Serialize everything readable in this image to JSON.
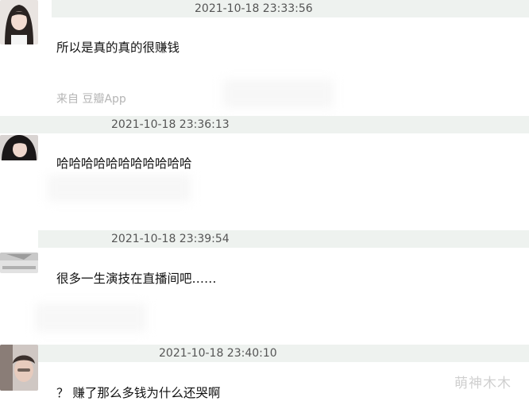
{
  "comments": [
    {
      "timestamp": "2021-10-18 23:33:56",
      "text": "所以是真的真的很赚钱",
      "source": "来自 豆瓣App"
    },
    {
      "timestamp": "2021-10-18 23:36:13",
      "text": "哈哈哈哈哈哈哈哈哈哈哈"
    },
    {
      "timestamp": "2021-10-18 23:39:54",
      "text": "很多一生演技在直播间吧……"
    },
    {
      "timestamp": "2021-10-18 23:40:10",
      "text": "？ 赚了那么多钱为什么还哭啊"
    }
  ],
  "watermark": "萌神木木",
  "colors": {
    "header_bg": "#eef2ef",
    "timestamp_text": "#555555",
    "body_text": "#111111",
    "source_text": "#b5b5b5"
  }
}
